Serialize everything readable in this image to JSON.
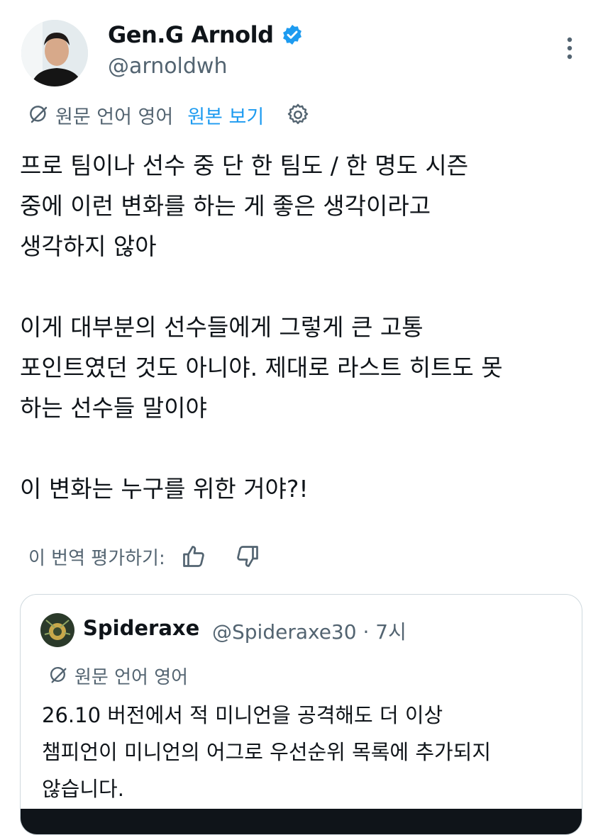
{
  "author": {
    "display_name": "Gen.G Arnold",
    "handle": "@arnoldwh",
    "verified": true,
    "avatar_icon": "profile-photo"
  },
  "translation": {
    "source_language_text": "원문 언어 영어",
    "show_original_label": "원본 보기",
    "rate_prompt": "이 번역 평가하기:"
  },
  "tweet": {
    "text": "프로 팀이나 선수 중 단 한 팀도 / 한 명도 시즌\n중에 이런 변화를 하는 게 좋은 생각이라고\n생각하지 않아\n\n이게 대부분의 선수들에게 그렇게 큰 고통\n포인트였던 것도 아니야. 제대로 라스트 히트도 못\n하는 선수들 말이야\n\n이 변화는 누구를 위한 거야?!"
  },
  "quoted_tweet": {
    "display_name": "Spideraxe",
    "handle_time": "@Spideraxe30 · 7시",
    "source_language_text": "원문 언어 영어",
    "text": "26.10 버전에서 적 미니언을 공격해도 더 이상\n챔피언이 미니언의 어그로 우선순위 목록에 추가되지\n않습니다."
  },
  "colors": {
    "text_primary": "#0f1419",
    "text_secondary": "#536471",
    "accent": "#1d9bf0",
    "border": "#cfd9de"
  }
}
